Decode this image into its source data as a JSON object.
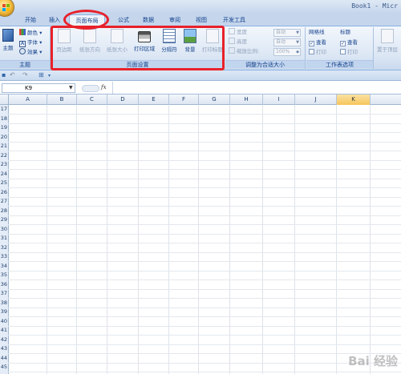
{
  "window": {
    "title": "Book1 - Micr"
  },
  "tabs": [
    {
      "label": "开始"
    },
    {
      "label": "插入"
    },
    {
      "label": "页面布局"
    },
    {
      "label": "公式"
    },
    {
      "label": "数据"
    },
    {
      "label": "审阅"
    },
    {
      "label": "视图"
    },
    {
      "label": "开发工具"
    }
  ],
  "active_tab": "页面布局",
  "ribbon": {
    "themes": {
      "theme_label": "主题",
      "colors_label": "颜色",
      "fonts_label": "字体",
      "effects_label": "效果",
      "group_label": "主题"
    },
    "page_setup": {
      "margins_label": "页边距",
      "orientation_label": "纸张方向",
      "size_label": "纸张大小",
      "print_area_label": "打印区域",
      "breaks_label": "分隔符",
      "background_label": "背景",
      "print_titles_label": "打印标题",
      "group_label": "页面设置"
    },
    "scale_to_fit": {
      "width_label": "宽度",
      "height_label": "高度",
      "scale_label": "缩放比例:",
      "width_value": "自动",
      "height_value": "自动",
      "scale_value": "100%",
      "group_label": "调整为合适大小"
    },
    "sheet_options": {
      "gridlines_label": "网格线",
      "headings_label": "标题",
      "view_label": "查看",
      "print_label": "打印",
      "group_label": "工作表选项"
    },
    "arrange": {
      "bring_to_front_label": "置于顶层"
    }
  },
  "formula_bar": {
    "name_box": "K9",
    "fx": "fx"
  },
  "columns": [
    "A",
    "B",
    "C",
    "D",
    "E",
    "F",
    "G",
    "H",
    "I",
    "J",
    "K"
  ],
  "selected_column": "K",
  "rows": [
    "17",
    "18",
    "19",
    "20",
    "21",
    "22",
    "23",
    "24",
    "25",
    "26",
    "27",
    "28",
    "29",
    "30",
    "31",
    "32",
    "33",
    "34",
    "35",
    "36",
    "37",
    "38",
    "39",
    "40",
    "41",
    "42",
    "43",
    "44",
    "45"
  ],
  "watermark": "Bai 经验"
}
